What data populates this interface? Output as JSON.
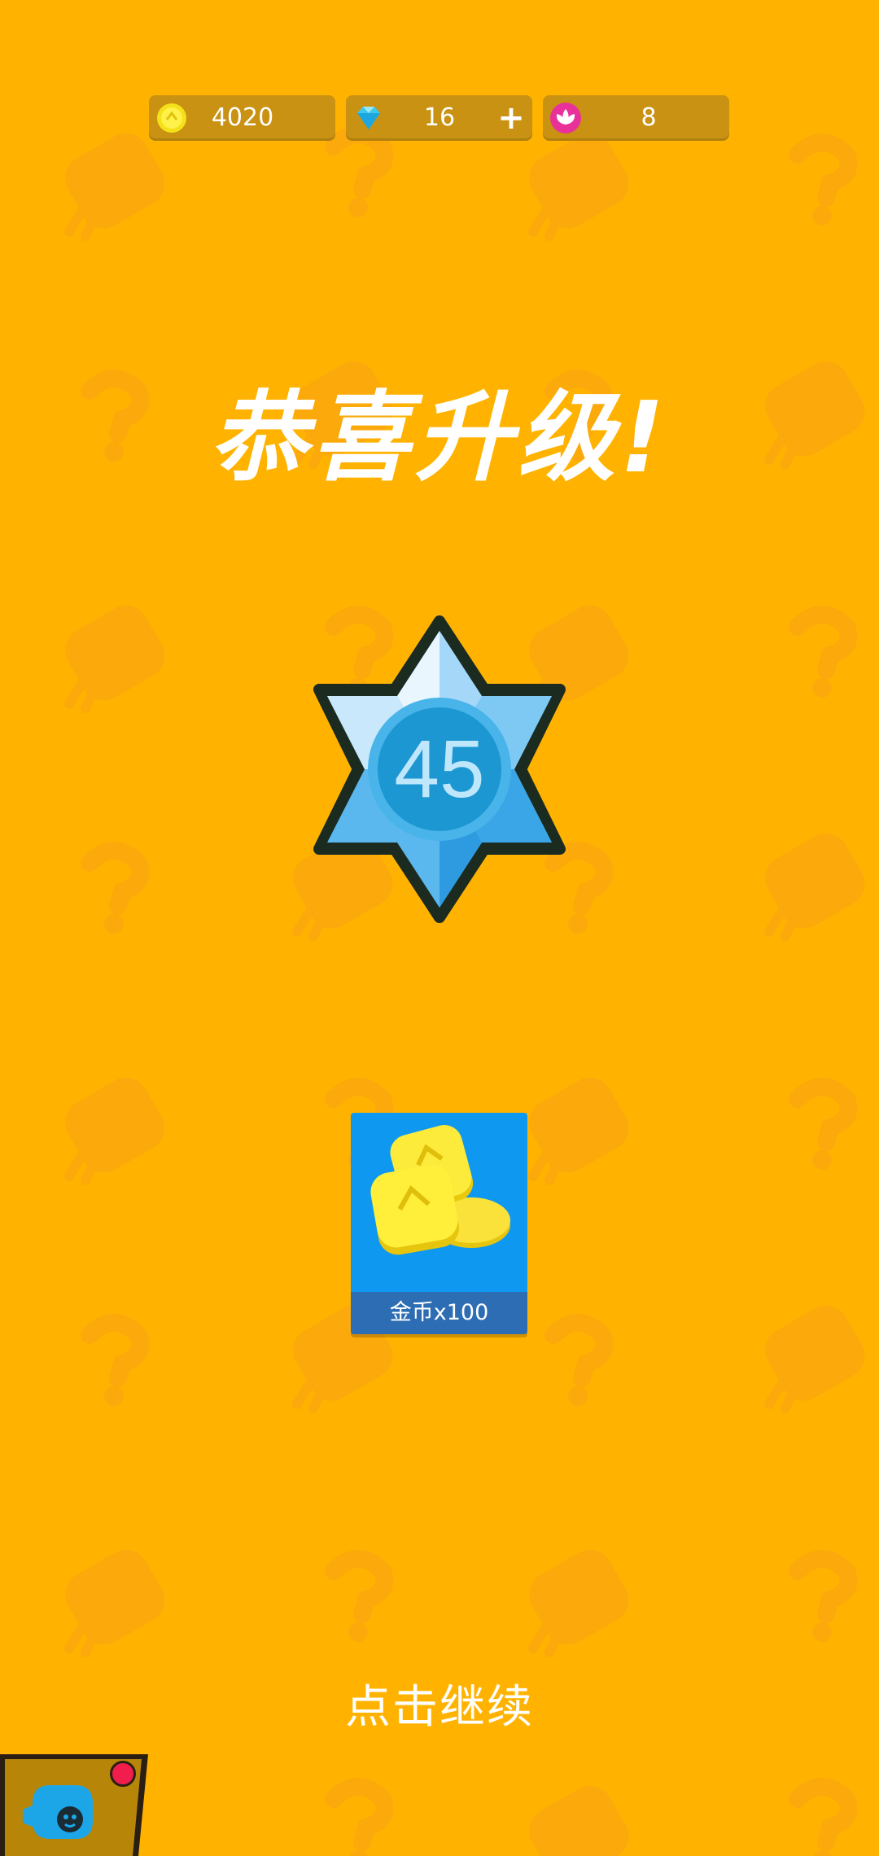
{
  "currency": {
    "coins": {
      "value": "4020",
      "icon": "coin-icon"
    },
    "gems": {
      "value": "16",
      "icon": "diamond-icon",
      "plus_label": "+"
    },
    "lotus": {
      "value": "8",
      "icon": "lotus-icon"
    }
  },
  "title": "恭喜升级!",
  "level": {
    "number": "45",
    "icon": "star-badge-icon"
  },
  "reward": {
    "label": "金币x100",
    "icon": "coins-pile-icon"
  },
  "continue_hint": "点击继续",
  "bottom_button": {
    "icon": "camera-icon",
    "notification_color": "#F01D4D"
  },
  "colors": {
    "background": "#FFB300",
    "pill": "#C99212",
    "card": "#0E98F0",
    "card_label": "#2C6DB3"
  }
}
